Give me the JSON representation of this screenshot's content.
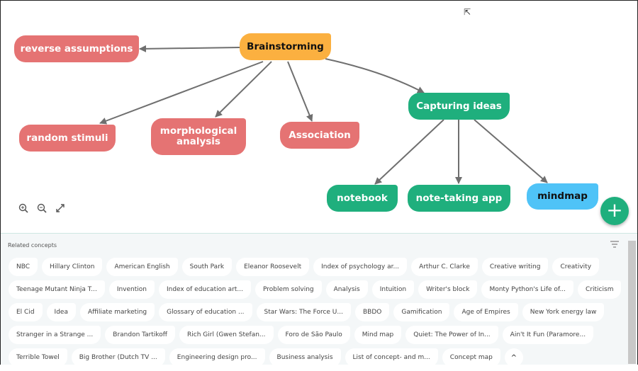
{
  "mindmap": {
    "nodes": {
      "root": "Brainstorming",
      "reverse": "reverse assumptions",
      "random": "random stimuli",
      "morph": "morphological analysis",
      "assoc": "Association",
      "capture": "Capturing ideas",
      "notebook": "notebook",
      "notetaking": "note-taking app",
      "mindmap": "mindmap"
    },
    "colors": {
      "red": "#e57373",
      "orange": "#fbb040",
      "green": "#1faf7d",
      "blue": "#4fc3f7"
    }
  },
  "controls": {
    "zoom_in": "zoom-in-icon",
    "zoom_out": "zoom-out-icon",
    "fit": "expand-icon",
    "add": "+"
  },
  "panel": {
    "title": "Related concepts",
    "rows": [
      [
        "NBC",
        "Hillary Clinton",
        "American English",
        "South Park",
        "Eleanor Roosevelt",
        "Index of psychology ar...",
        "Arthur C. Clarke",
        "Creative writing",
        "Creativity"
      ],
      [
        "Teenage Mutant Ninja T...",
        "Invention",
        "Index of education art...",
        "Problem solving",
        "Analysis",
        "Intuition",
        "Writer's block",
        "Monty Python's Life of...",
        "Criticism"
      ],
      [
        "El Cid",
        "Idea",
        "Affiliate marketing",
        "Glossary of education ...",
        "Star Wars: The Force U...",
        "BBDO",
        "Gamification",
        "Age of Empires",
        "New York energy law"
      ],
      [
        "Stranger in a Strange ...",
        "Brandon Tartikoff",
        "Rich Girl (Gwen Stefan...",
        "Foro de São Paulo",
        "Mind map",
        "Quiet: The Power of In...",
        "Ain't It Fun (Paramore..."
      ],
      [
        "Terrible Towel",
        "Big Brother (Dutch TV ...",
        "Engineering design pro...",
        "Business analysis",
        "List of concept- and m...",
        "Concept map"
      ]
    ],
    "collapse": "^"
  }
}
